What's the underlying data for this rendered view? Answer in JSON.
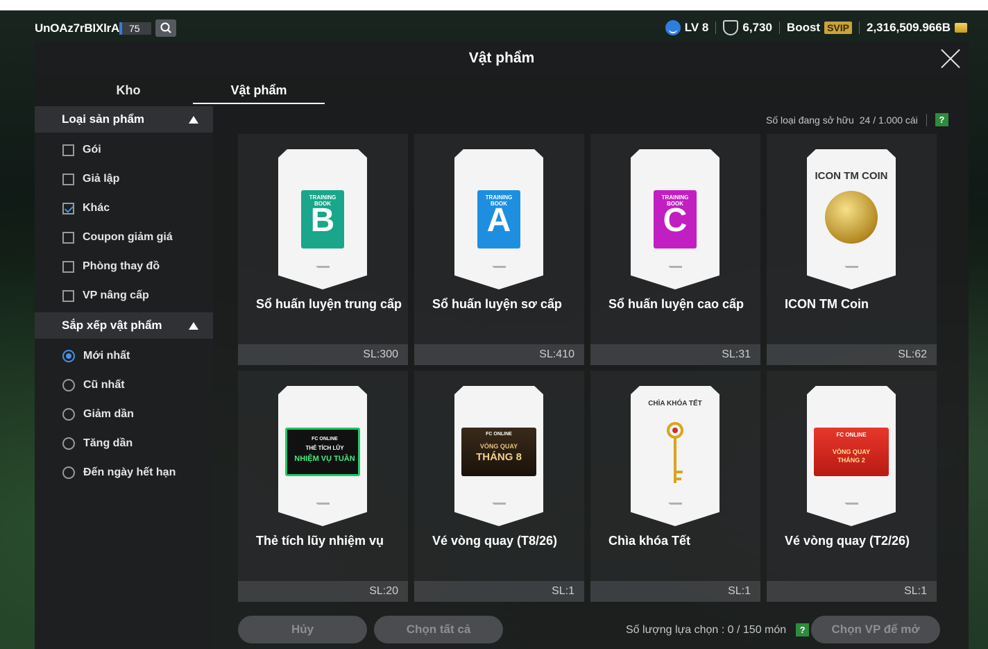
{
  "topbar": {
    "username": "UnOAz7rBIXlrAa",
    "level_num": "75",
    "lv": "LV 8",
    "trophy": "6,730",
    "boost": "Boost",
    "svip": "SVIP",
    "balance": "2,316,509.966B"
  },
  "modal": {
    "title": "Vật phẩm"
  },
  "tabs": [
    {
      "label": "Kho"
    },
    {
      "label": "Vật phẩm"
    }
  ],
  "sidebar": {
    "filter_title": "Loại sản phẩm",
    "filters": [
      {
        "label": "Gói",
        "checked": false
      },
      {
        "label": "Giả lập",
        "checked": false
      },
      {
        "label": "Khác",
        "checked": true
      },
      {
        "label": "Coupon giảm giá",
        "checked": false
      },
      {
        "label": "Phòng thay đồ",
        "checked": false
      },
      {
        "label": "VP nâng cấp",
        "checked": false
      }
    ],
    "sort_title": "Sắp xếp vật phẩm",
    "sorts": [
      {
        "label": "Mới nhất",
        "selected": true
      },
      {
        "label": "Cũ nhất",
        "selected": false
      },
      {
        "label": "Giảm dần",
        "selected": false
      },
      {
        "label": "Tăng dần",
        "selected": false
      },
      {
        "label": "Đến ngày hết hạn",
        "selected": false
      }
    ]
  },
  "owned": {
    "label": "Số loại đang sở hữu",
    "value": "24 / 1.000 cái",
    "help": "?"
  },
  "items": [
    {
      "name": "Sổ huấn luyện trung cấp",
      "qty": "SL:300",
      "art": {
        "kind": "book",
        "top": "TRAINING BOOK",
        "letter": "B",
        "color": "#1aa68a"
      }
    },
    {
      "name": "Sổ huấn luyện sơ cấp",
      "qty": "SL:410",
      "art": {
        "kind": "book",
        "top": "TRAINING BOOK",
        "letter": "A",
        "color": "#1e8fe0"
      }
    },
    {
      "name": "Sổ huấn luyện cao cấp",
      "qty": "SL:31",
      "art": {
        "kind": "book",
        "top": "TRAINING BOOK",
        "letter": "C",
        "color": "#c21fc2"
      }
    },
    {
      "name": "ICON TM Coin",
      "qty": "SL:62",
      "art": {
        "kind": "coin",
        "caption": "ICON TM COIN"
      }
    },
    {
      "name": "Thẻ tích lũy nhiệm vụ",
      "qty": "SL:20",
      "art": {
        "kind": "banner",
        "line1": "FC ONLINE",
        "line2": "THẺ TÍCH LŨY",
        "line3": "NHIỆM VỤ TUẦN",
        "color": "#111111"
      }
    },
    {
      "name": "Vé vòng quay (T8/26)",
      "qty": "SL:1",
      "art": {
        "kind": "banner",
        "line1": "FC ONLINE",
        "line2": "VÒNG QUAY",
        "line3": "THÁNG 8",
        "color": "#3a2a1a"
      }
    },
    {
      "name": "Chìa khóa Tết",
      "qty": "SL:1",
      "art": {
        "kind": "key",
        "caption": "CHÌA KHÓA TẾT"
      }
    },
    {
      "name": "Vé vòng quay (T2/26)",
      "qty": "SL:1",
      "art": {
        "kind": "banner",
        "line1": "FC ONLINE",
        "line2": "VÒNG QUAY",
        "line3": "THÁNG 2",
        "color": "#d8261e"
      }
    }
  ],
  "footer": {
    "cancel": "Hủy",
    "select_all": "Chọn tất cả",
    "selection_label": "Số lượng lựa chọn : 0 / 150 món",
    "help": "?",
    "open": "Chọn VP để mở"
  }
}
